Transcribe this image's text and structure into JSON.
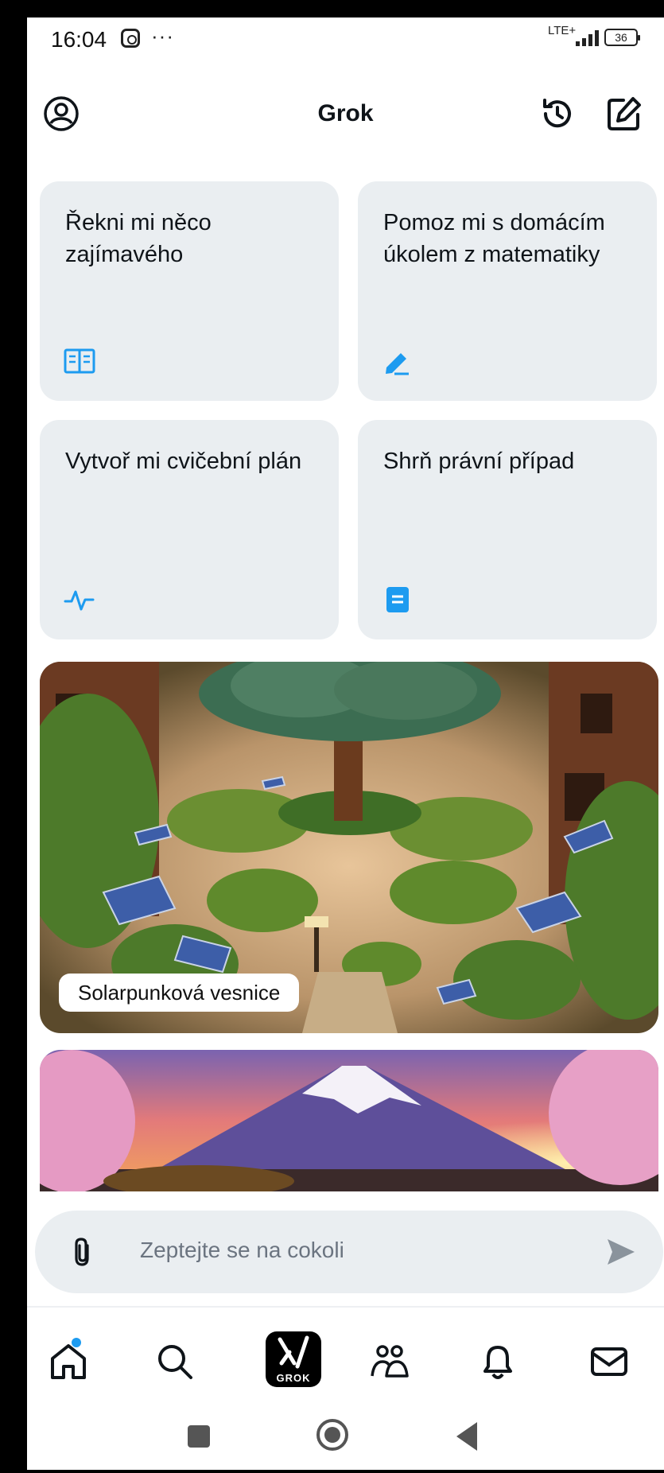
{
  "status_bar": {
    "time": "16:04",
    "dots": "···",
    "network": "LTE+",
    "battery": "36"
  },
  "header": {
    "title": "Grok",
    "icons": [
      "profile-icon",
      "history-icon",
      "compose-icon"
    ]
  },
  "suggestions": [
    {
      "text": "Řekni mi něco zajímavého",
      "icon": "book-icon"
    },
    {
      "text": "Pomoz mi s domácím úkolem z matematiky",
      "icon": "pencil-icon"
    },
    {
      "text": "Vytvoř mi cvičební plán",
      "icon": "activity-icon"
    },
    {
      "text": "Shrň právní případ",
      "icon": "document-icon"
    }
  ],
  "image_cards": [
    {
      "caption": "Solarpunková vesnice"
    },
    {
      "caption": ""
    }
  ],
  "composer": {
    "placeholder": "Zeptejte se na cokoli"
  },
  "bottom_nav": {
    "items": [
      "home-icon",
      "search-icon",
      "grok-icon",
      "communities-icon",
      "notifications-icon",
      "messages-icon"
    ],
    "grok_label": "GROK"
  },
  "colors": {
    "accent": "#1d9bf0",
    "card_bg": "#eaeef1",
    "frame": "#7a1cff"
  }
}
